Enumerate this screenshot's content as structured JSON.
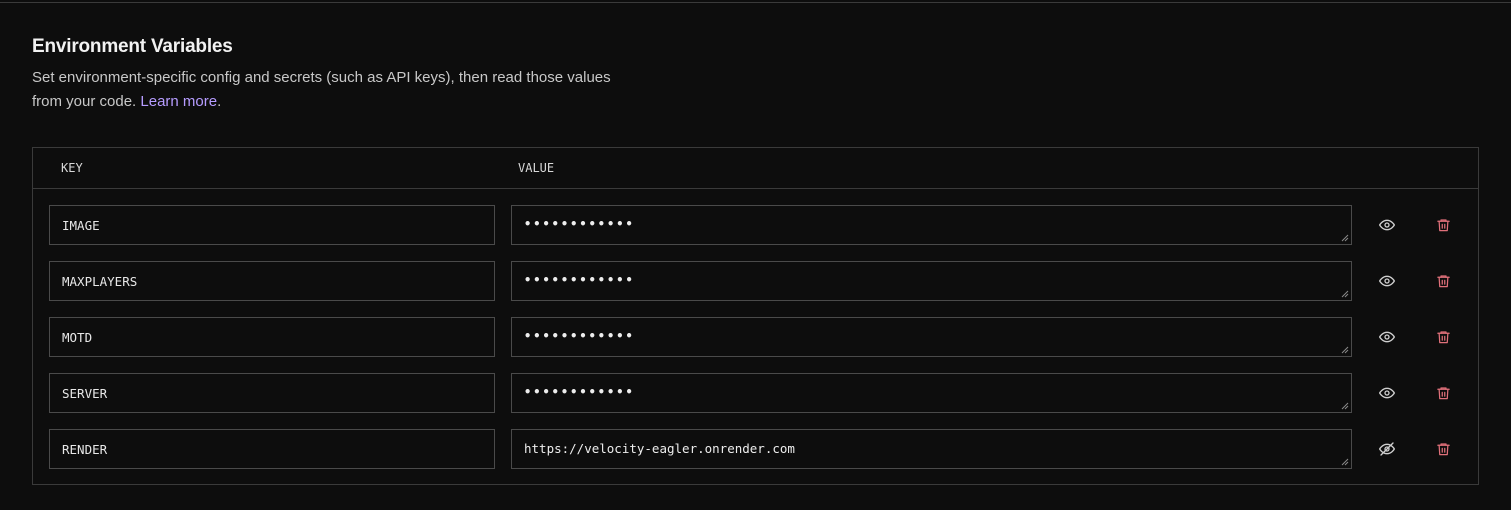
{
  "section": {
    "title": "Environment Variables",
    "description": "Set environment-specific config and secrets (such as API keys), then read those values from your code.",
    "learn_more": "Learn more",
    "period": "."
  },
  "table": {
    "key_header": "KEY",
    "value_header": "VALUE"
  },
  "rows": [
    {
      "key": "IMAGE",
      "value": "••••••••••••",
      "masked": true,
      "eye_icon": "eye-icon"
    },
    {
      "key": "MAXPLAYERS",
      "value": "••••••••••••",
      "masked": true,
      "eye_icon": "eye-icon"
    },
    {
      "key": "MOTD",
      "value": "••••••••••••",
      "masked": true,
      "eye_icon": "eye-icon"
    },
    {
      "key": "SERVER",
      "value": "••••••••••••",
      "masked": true,
      "eye_icon": "eye-icon"
    },
    {
      "key": "RENDER",
      "value": "https://velocity-eagler.onrender.com",
      "masked": false,
      "eye_icon": "eye-off-icon"
    }
  ],
  "colors": {
    "background": "#0d0d0d",
    "border": "#3a3a3a",
    "link": "#b69cff",
    "trash": "#e0707a"
  }
}
